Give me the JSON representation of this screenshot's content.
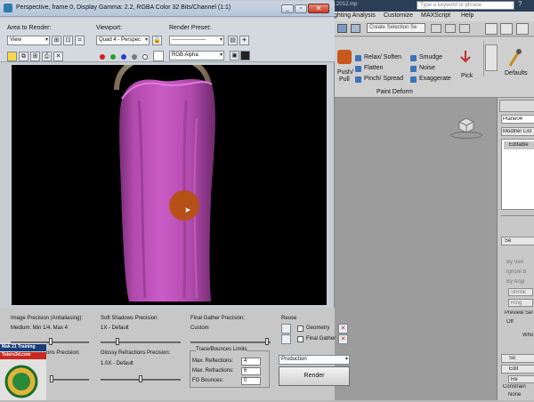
{
  "bg": {
    "title_text": "073_AnAsomona 8 and nor1.2012.mp",
    "search_placeholder": "Type a keyword or phrase",
    "help_q": "?",
    "menu": [
      "ghting Analysis",
      "Customize",
      "MAXScript",
      "Help"
    ],
    "selection_set": "Create Selection Se",
    "ribbon": {
      "push_pull_1": "Push/",
      "push_pull_2": "Pull",
      "relax": "Relax/ Soften",
      "flatten": "Flatten",
      "pinch": "Pinch/ Spread",
      "smudge": "Smudge",
      "noise": "Noise",
      "exaggerate": "Exaggerate",
      "pick": "Pick",
      "defaults": "Defaults",
      "group_label": "Paint Deform"
    },
    "cmdpanel": {
      "object_name": "Plane04",
      "modifier_list": "Modifier List",
      "editable": "Editable",
      "sel_label": "Se",
      "by_vertex": "By Vert",
      "ignore_b": "Ignore B",
      "by_angle": "By Angl",
      "shrink": "Shrink",
      "ring": "Ring",
      "preview_sel": "Preview Sel",
      "off": "Off",
      "who": "Who",
      "so": "So",
      "edit": "Edit",
      "re": "Re",
      "constraints": "Constrain",
      "none": "None"
    },
    "accent_blue": "#2a3f55"
  },
  "frame": {
    "title": "Perspective, frame 0, Display Gamma: 2.2, RGBA Color 32 Bits/Channel (1:1)",
    "minimize": "_",
    "restore": "▫",
    "close": "✕",
    "area_label": "Area to Render:",
    "area_value": "View",
    "viewport_label": "Viewport:",
    "viewport_value": "Quad 4 - Perspec",
    "preset_label": "Render Preset:",
    "preset_value": "-------------------",
    "channel_value": "RGB Alpha",
    "channel_colors": [
      "#d42020",
      "#2aa02a",
      "#2040d0"
    ]
  },
  "panel": {
    "img_precision_label": "Image Precision (Antialiasing):",
    "img_precision_value": "Medium: Min 1/4, Max 4",
    "soft_shadows_label": "Soft Shadows Precision:",
    "soft_shadows_value": "1X - Default",
    "final_gather_label": "Final Gather Precision:",
    "final_gather_value": "Custom",
    "reuse_label": "Reuse",
    "geometry_label": "Geometry",
    "final_gather_cb_label": "Final Gather",
    "glossy_refl_label": "Glossy Reflections Precision:",
    "glossy_refr_label": "Glossy Refractions Precision:",
    "glossy_refr_value": "1.0X - Default",
    "trace_label": "Trace/Bounces Limits",
    "max_refl_label": "Max. Reflections:",
    "max_refl_value": "4",
    "max_refr_label": "Max. Refractions:",
    "max_refr_value": "6",
    "fg_bounces_label": "FG Bounces:",
    "fg_bounces_value": "0",
    "production": "Production",
    "render": "Render"
  },
  "logo": {
    "line1": "Mak 21 Training",
    "line2": "Tuters3d.com"
  }
}
